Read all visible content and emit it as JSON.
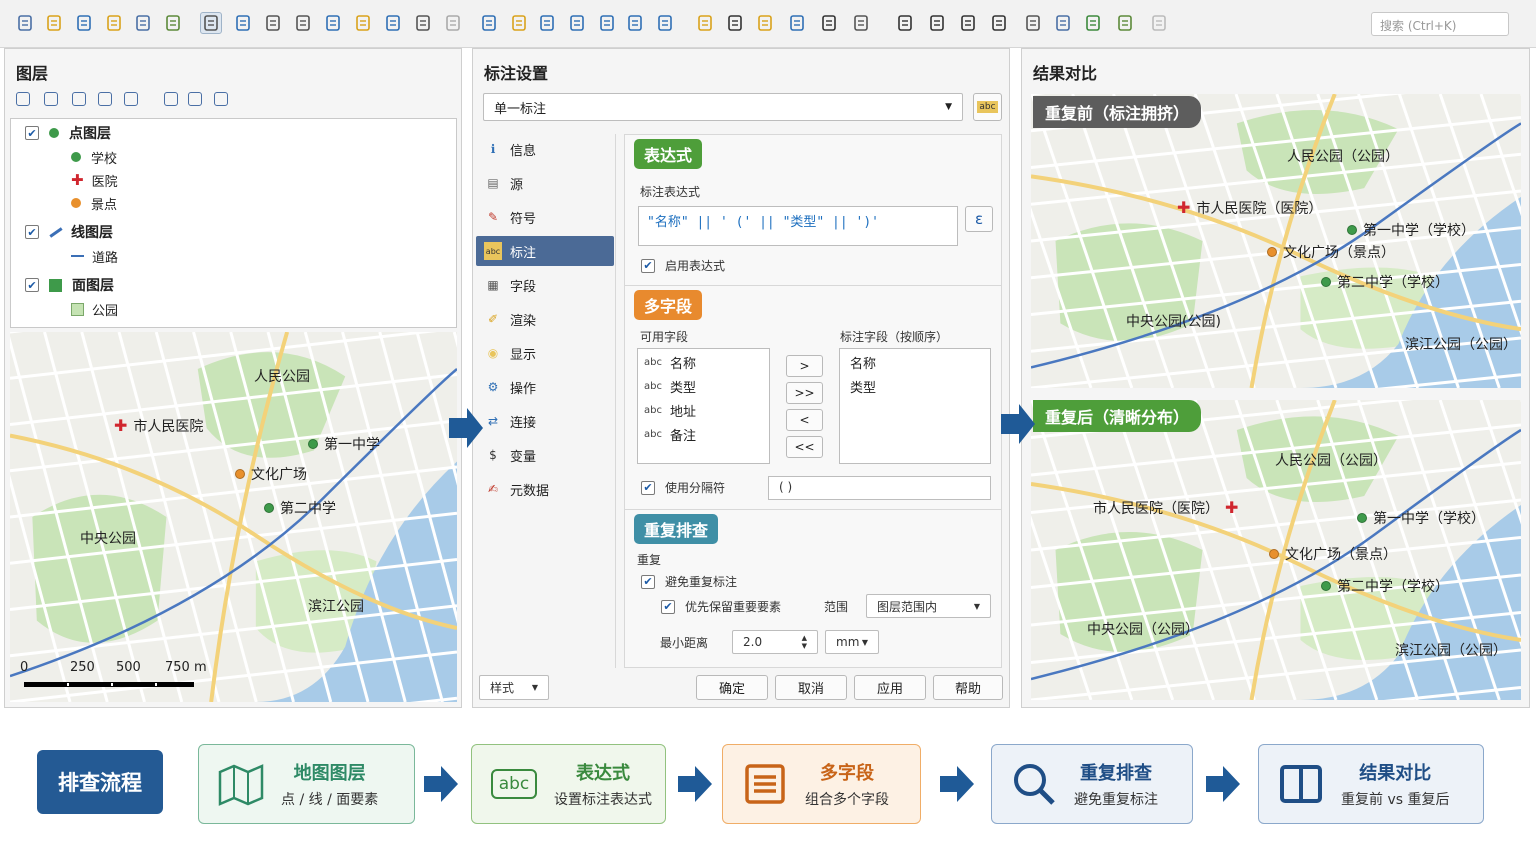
{
  "toolbar": {
    "icons": [
      "new-file-icon",
      "open-folder-icon",
      "save-icon",
      "save-as-icon",
      "print-icon",
      "tools-icon",
      "pan-hand-icon",
      "move-icon",
      "zoom-in-icon",
      "zoom-out-icon",
      "zoom-extent-icon",
      "select-icon",
      "identify-icon",
      "zoom-layer-icon",
      "clear-icon",
      "page-icon",
      "chart-icon",
      "bookmark-icon",
      "document-icon",
      "text-icon",
      "image-icon",
      "refresh-icon",
      "pencil-icon",
      "font-icon",
      "warning-icon",
      "measure-icon",
      "sum-icon",
      "sparkle-icon",
      "settings-icon",
      "timer-icon",
      "clock-icon",
      "sigma-icon",
      "table-icon",
      "edit-icon",
      "draw-icon",
      "plugin-icon",
      "ai-icon"
    ],
    "search_placeholder": "搜索 (Ctrl+K)"
  },
  "layers": {
    "title": "图层",
    "tree": [
      {
        "label": "点图层",
        "type": "point-group",
        "children": [
          {
            "label": "学校",
            "color": "#3e9a4a"
          },
          {
            "label": "医院",
            "color": "#d0262e"
          },
          {
            "label": "景点",
            "color": "#e8902d"
          }
        ]
      },
      {
        "label": "线图层",
        "type": "line-group",
        "children": [
          {
            "label": "道路",
            "color": "#3b6fb6"
          }
        ]
      },
      {
        "label": "面图层",
        "type": "polygon-group",
        "children": [
          {
            "label": "公园",
            "color": "#c5e3b3"
          }
        ]
      }
    ],
    "map_labels": {
      "park1": "人民公园",
      "hospital": "市人民医院",
      "school1": "第一中学",
      "plaza": "文化广场",
      "school2": "第二中学",
      "park2": "中央公园",
      "park3": "滨江公园"
    },
    "scale": [
      "0",
      "250",
      "500",
      "750 m"
    ]
  },
  "label_settings": {
    "title": "标注设置",
    "mode": "单一标注",
    "nav": [
      "信息",
      "源",
      "符号",
      "标注",
      "字段",
      "渲染",
      "显示",
      "操作",
      "连接",
      "变量",
      "元数据"
    ],
    "nav_selected": "标注",
    "expression_section": {
      "badge": "表达式",
      "label": "标注表达式",
      "value": "\"名称\"  ||  ' ('  ||  \"类型\"  ||  ')'",
      "enable": "启用表达式",
      "epsilon_button": "ε"
    },
    "multi_field_section": {
      "badge": "多字段",
      "available_label": "可用字段",
      "available": [
        "名称",
        "类型",
        "地址",
        "备注"
      ],
      "field_prefix": "abc",
      "selected_label": "标注字段（按顺序）",
      "selected": [
        "名称",
        "类型"
      ],
      "move_buttons": [
        ">",
        ">>",
        "<",
        "<<"
      ],
      "use_separator": "使用分隔符",
      "separator_value": "( )"
    },
    "duplicate_section": {
      "badge": "重复排查",
      "group_label": "重复",
      "avoid": "避免重复标注",
      "priority": "优先保留重要要素",
      "range_label": "范围",
      "range_value": "图层范围内",
      "min_distance_label": "最小距离",
      "min_distance_value": "2.0",
      "unit": "mm"
    },
    "footer": {
      "style": "样式",
      "ok": "确定",
      "cancel": "取消",
      "apply": "应用",
      "help": "帮助"
    }
  },
  "compare": {
    "title": "结果对比",
    "before": {
      "banner": "重复前（标注拥挤）",
      "labels": {
        "park1": "人民公园（公园）",
        "hospital": "市人民医院（医院）",
        "school1": "第一中学（学校）",
        "plaza": "文化广场（景点）",
        "school2": "第二中学（学校）",
        "park2": "中央公园(公园)",
        "park3": "滨江公园（公园）"
      }
    },
    "after": {
      "banner": "重复后（清晰分布）",
      "labels": {
        "park1": "人民公园（公园）",
        "hospital": "市人民医院（医院）",
        "school1": "第一中学（学校）",
        "plaza": "文化广场（景点）",
        "school2": "第二中学（学校）",
        "park2": "中央公园（公园）",
        "park3": "滨江公园（公园）"
      }
    }
  },
  "flow": {
    "start": "排查流程",
    "steps": [
      {
        "title": "地图图层",
        "sub": "点 / 线 / 面要素",
        "icon": "map-icon",
        "color": "#2e8a66"
      },
      {
        "title": "表达式",
        "sub": "设置标注表达式",
        "icon": "abc-icon",
        "icon_text": "abc",
        "color": "#3a8a3e"
      },
      {
        "title": "多字段",
        "sub": "组合多个字段",
        "icon": "list-icon",
        "color": "#c86418"
      },
      {
        "title": "重复排查",
        "sub": "避免重复标注",
        "icon": "search-icon",
        "color": "#1f4e86"
      },
      {
        "title": "结果对比",
        "sub": "重复前 vs 重复后",
        "icon": "compare-icon",
        "color": "#1f4e86"
      }
    ]
  },
  "colors": {
    "accent_blue": "#1f5a97",
    "nav_selected": "#4b6a96",
    "badge_green": "#4e9e3a",
    "badge_orange": "#e88a2e",
    "badge_teal": "#3f8fa6"
  }
}
